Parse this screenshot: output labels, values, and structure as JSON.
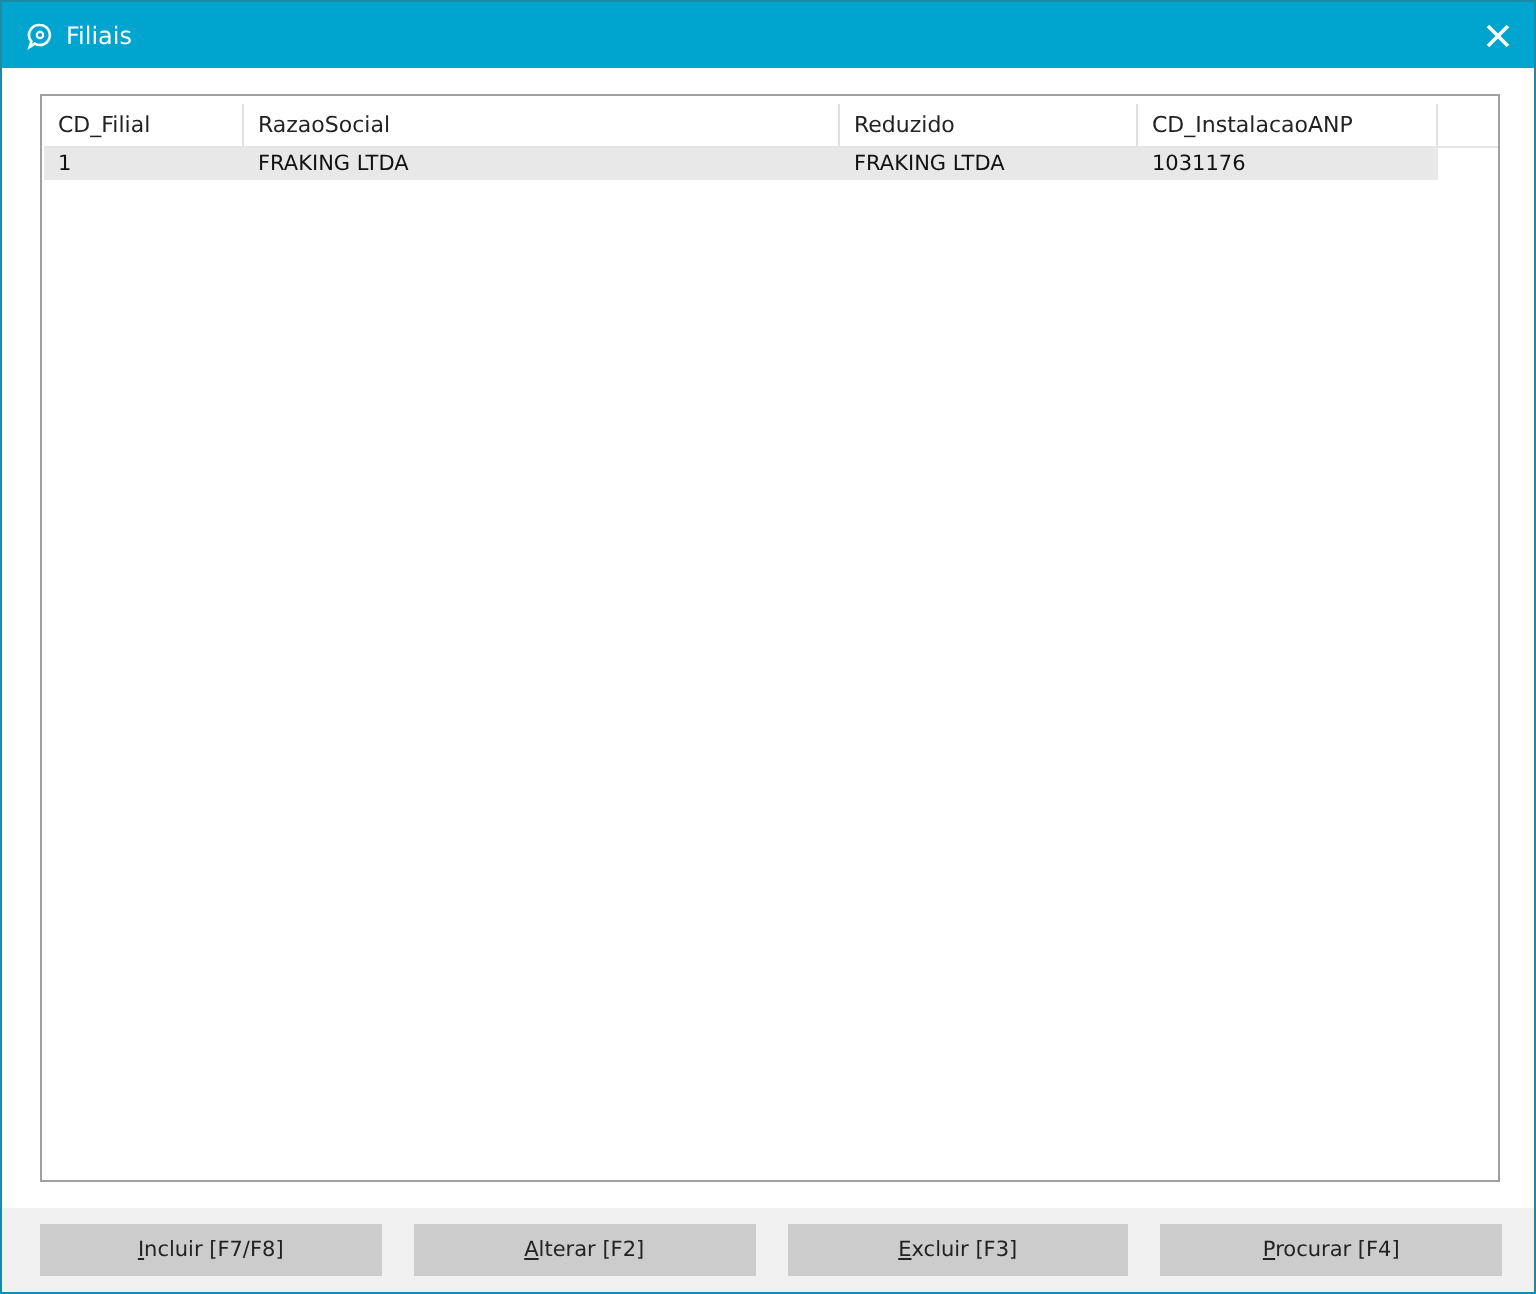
{
  "window": {
    "title": "Filiais"
  },
  "table": {
    "columns": [
      "CD_Filial",
      "RazaoSocial",
      "Reduzido",
      "CD_InstalacaoANP"
    ],
    "rows": [
      {
        "cells": [
          "1",
          "FRAKING LTDA",
          "FRAKING LTDA",
          "1031176"
        ],
        "selected": true
      }
    ]
  },
  "buttons": [
    "Incluir [F7/F8]",
    "Alterar [F2]",
    "Excluir [F3]",
    "Procurar [F4]"
  ]
}
